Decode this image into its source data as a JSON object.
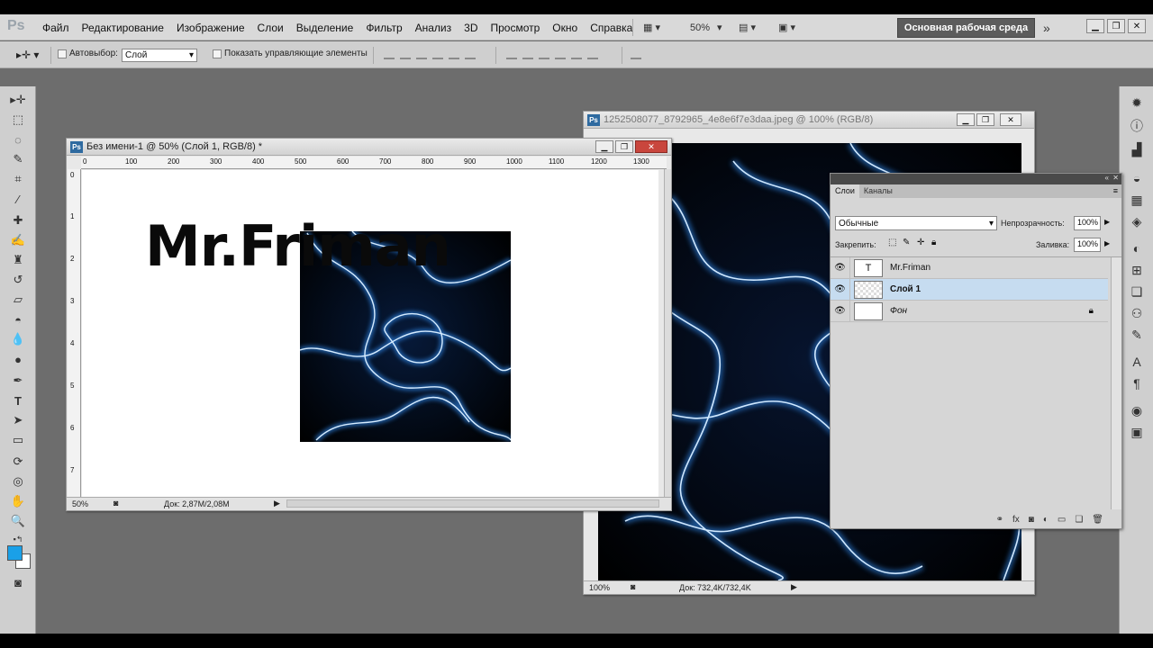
{
  "app": {
    "logo": "Ps",
    "menu": [
      "Файл",
      "Редактирование",
      "Изображение",
      "Слои",
      "Выделение",
      "Фильтр",
      "Анализ",
      "3D",
      "Просмотр",
      "Окно",
      "Справка"
    ],
    "zoom_select": "50%",
    "workspace": "Основная рабочая среда",
    "expand_icon": "»"
  },
  "options_bar": {
    "autoselect_label": "Автовыбор:",
    "autoselect_value": "Слой",
    "show_controls_label": "Показать управляющие элементы"
  },
  "doc1": {
    "title": "Без имени-1 @ 50% (Слой 1, RGB/8) *",
    "ruler_h": [
      "0",
      "100",
      "200",
      "300",
      "400",
      "500",
      "600",
      "700",
      "800",
      "900",
      "1000",
      "1100",
      "1200",
      "1300"
    ],
    "ruler_v": [
      "0",
      "1",
      "2",
      "3",
      "4",
      "5",
      "6",
      "7"
    ],
    "text_layer": "Mr.Friman",
    "zoom": "50%",
    "doc_size": "Док: 2,87M/2,08M"
  },
  "doc2": {
    "title": "1252508077_8792965_4e8e6f7e3daa.jpeg @ 100% (RGB/8)",
    "zoom": "100%",
    "doc_size": "Док: 732,4K/732,4K"
  },
  "layers_panel": {
    "tabs": [
      "Слои",
      "Каналы"
    ],
    "blend_mode": "Обычные",
    "opacity_label": "Непрозрачность:",
    "opacity_value": "100%",
    "lock_label": "Закрепить:",
    "fill_label": "Заливка:",
    "fill_value": "100%",
    "layers": [
      {
        "name": "Mr.Friman",
        "thumb": "T"
      },
      {
        "name": "Слой 1",
        "thumb": ""
      },
      {
        "name": "Фон",
        "thumb": ""
      }
    ]
  },
  "colors": {
    "foreground": "#1aa0e8",
    "background": "#ffffff",
    "selected_layer": "#c6dcf0"
  }
}
